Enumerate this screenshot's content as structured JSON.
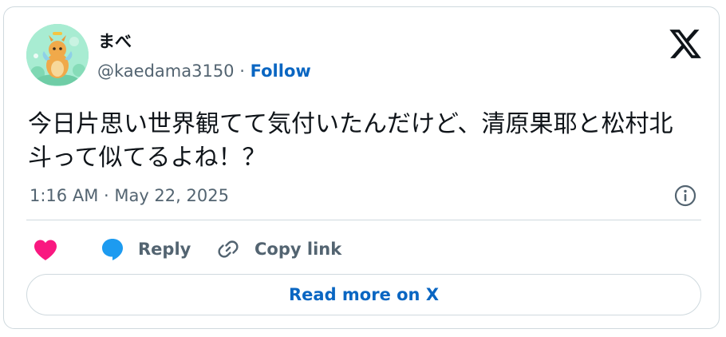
{
  "tweet": {
    "author": {
      "display_name": "まべ",
      "handle": "@kaedama3150",
      "separator": "·",
      "follow_label": "Follow"
    },
    "text": "今日片思い世界観てて気付いたんだけど、清原果耶と松村北斗って似てるよね！？",
    "timestamp": "1:16 AM · May 22, 2025"
  },
  "actions": {
    "reply_label": "Reply",
    "copy_link_label": "Copy link"
  },
  "read_more_label": "Read more on X",
  "icons": {
    "logo": "x-logo-icon",
    "info": "info-icon",
    "like": "heart-icon",
    "reply": "speech-bubble-icon",
    "copy": "link-icon"
  },
  "colors": {
    "accent": "#0a66c2",
    "heart": "#f91880",
    "reply_bubble": "#1d9bf0",
    "text": "#0f1419",
    "muted": "#536471",
    "border": "#cfd9de"
  }
}
